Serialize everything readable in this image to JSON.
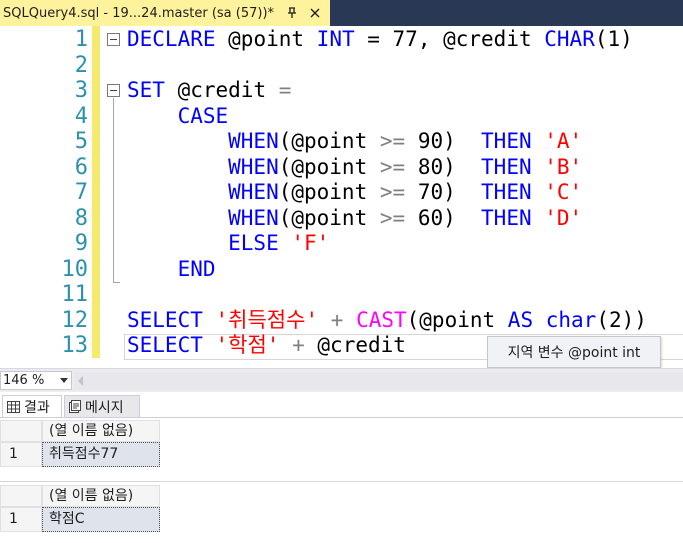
{
  "tab": {
    "title": "SQLQuery4.sql - 19...24.master (sa (57))*"
  },
  "editor": {
    "line_numbers": [
      "1",
      "2",
      "3",
      "4",
      "5",
      "6",
      "7",
      "8",
      "9",
      "10",
      "11",
      "12",
      "13"
    ],
    "lines": [
      [
        {
          "t": "DECLARE",
          "c": "kw"
        },
        {
          "t": " @point ",
          "c": ""
        },
        {
          "t": "INT",
          "c": "kw"
        },
        {
          "t": " = 77, @credit ",
          "c": ""
        },
        {
          "t": "CHAR",
          "c": "kw"
        },
        {
          "t": "(1)",
          "c": ""
        }
      ],
      [],
      [
        {
          "t": "SET",
          "c": "kw"
        },
        {
          "t": " @credit ",
          "c": ""
        },
        {
          "t": "=",
          "c": "op"
        }
      ],
      [
        {
          "t": "    CASE",
          "c": "kw"
        }
      ],
      [
        {
          "t": "        WHEN",
          "c": "kw"
        },
        {
          "t": "(@point ",
          "c": ""
        },
        {
          "t": ">=",
          "c": "op"
        },
        {
          "t": " 90)  ",
          "c": ""
        },
        {
          "t": "THEN",
          "c": "kw"
        },
        {
          "t": " ",
          "c": ""
        },
        {
          "t": "'A'",
          "c": "st"
        }
      ],
      [
        {
          "t": "        WHEN",
          "c": "kw"
        },
        {
          "t": "(@point ",
          "c": ""
        },
        {
          "t": ">=",
          "c": "op"
        },
        {
          "t": " 80)  ",
          "c": ""
        },
        {
          "t": "THEN",
          "c": "kw"
        },
        {
          "t": " ",
          "c": ""
        },
        {
          "t": "'B'",
          "c": "st"
        }
      ],
      [
        {
          "t": "        WHEN",
          "c": "kw"
        },
        {
          "t": "(@point ",
          "c": ""
        },
        {
          "t": ">=",
          "c": "op"
        },
        {
          "t": " 70)  ",
          "c": ""
        },
        {
          "t": "THEN",
          "c": "kw"
        },
        {
          "t": " ",
          "c": ""
        },
        {
          "t": "'C'",
          "c": "st"
        }
      ],
      [
        {
          "t": "        WHEN",
          "c": "kw"
        },
        {
          "t": "(@point ",
          "c": ""
        },
        {
          "t": ">=",
          "c": "op"
        },
        {
          "t": " 60)  ",
          "c": ""
        },
        {
          "t": "THEN",
          "c": "kw"
        },
        {
          "t": " ",
          "c": ""
        },
        {
          "t": "'D'",
          "c": "st"
        }
      ],
      [
        {
          "t": "        ELSE",
          "c": "kw"
        },
        {
          "t": " ",
          "c": ""
        },
        {
          "t": "'F'",
          "c": "st"
        }
      ],
      [
        {
          "t": "    END",
          "c": "kw"
        }
      ],
      [],
      [
        {
          "t": "SELECT",
          "c": "kw"
        },
        {
          "t": " ",
          "c": ""
        },
        {
          "t": "'취득점수'",
          "c": "st"
        },
        {
          "t": " ",
          "c": ""
        },
        {
          "t": "+",
          "c": "op"
        },
        {
          "t": " ",
          "c": ""
        },
        {
          "t": "CAST",
          "c": "fn"
        },
        {
          "t": "(@point ",
          "c": ""
        },
        {
          "t": "AS",
          "c": "kw"
        },
        {
          "t": " ",
          "c": ""
        },
        {
          "t": "char",
          "c": "kw"
        },
        {
          "t": "(2))",
          "c": ""
        }
      ],
      [
        {
          "t": "SELECT",
          "c": "kw"
        },
        {
          "t": " ",
          "c": ""
        },
        {
          "t": "'학점'",
          "c": "st"
        },
        {
          "t": " ",
          "c": ""
        },
        {
          "t": "+",
          "c": "op"
        },
        {
          "t": " @credit",
          "c": ""
        }
      ]
    ],
    "colors": {
      "keyword": "#0000ff",
      "function": "#ff00ff",
      "string": "#ff0000",
      "operator": "#808080",
      "line_number": "#2b91af",
      "change_bar": "#f5ea6e"
    },
    "tooltip": "지역 변수 @point int"
  },
  "status": {
    "zoom": "146 %"
  },
  "results_tabs": {
    "results_label": "결과",
    "messages_label": "메시지"
  },
  "grids": [
    {
      "column_header": "(열 이름 없음)",
      "row_number": "1",
      "value": "취득점수77"
    },
    {
      "column_header": "(열 이름 없음)",
      "row_number": "1",
      "value": "학점C"
    }
  ]
}
